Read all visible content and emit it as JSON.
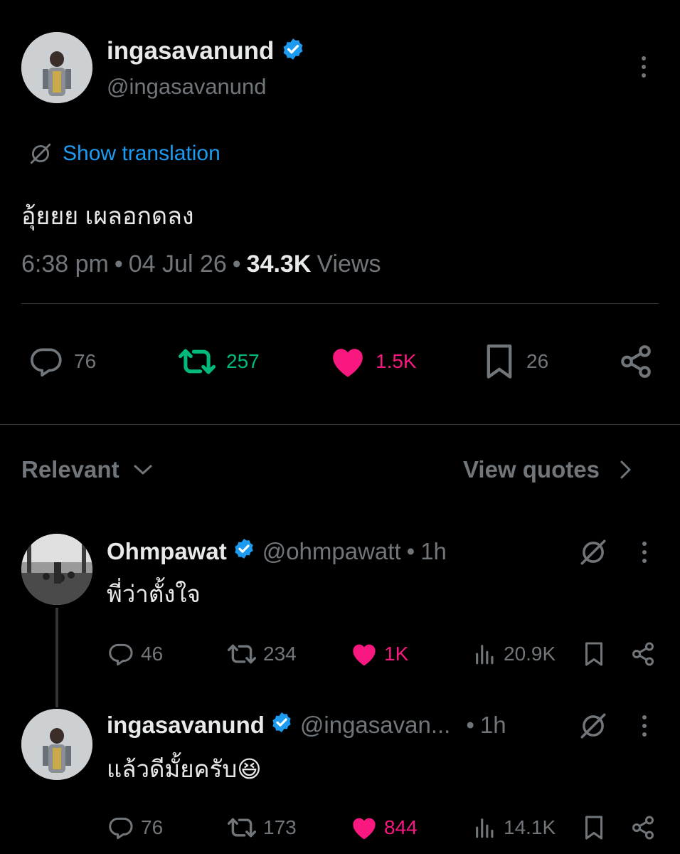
{
  "tweet": {
    "author_name": "ingasavanund",
    "author_handle": "@ingasavanund",
    "translate_label": "Show translation",
    "text": "อุ้ยยย เผลอกดลง",
    "time": "6:38 pm",
    "date": "04 Jul 26",
    "views_count": "34.3K",
    "views_label": "Views",
    "replies": "76",
    "retweets": "257",
    "likes": "1.5K",
    "bookmarks": "26"
  },
  "sort": {
    "label": "Relevant",
    "view_quotes": "View quotes"
  },
  "replies": [
    {
      "name": "Ohmpawat",
      "handle": "@ohmpawatt",
      "time": "1h",
      "text": "พี่ว่าตั้งใจ",
      "replies": "46",
      "retweets": "234",
      "likes": "1K",
      "views": "20.9K"
    },
    {
      "name": "ingasavanund",
      "handle": "@ingasavan...",
      "time": "1h",
      "text": "แล้วดีมั้ยครับ😆",
      "replies": "76",
      "retweets": "173",
      "likes": "844",
      "views": "14.1K"
    }
  ],
  "colors": {
    "background": "#000000",
    "text": "#e7e9ea",
    "muted": "#71767b",
    "link": "#1d9bf0",
    "retweet": "#00ba7c",
    "like": "#f91880",
    "verified": "#1d9bf0"
  },
  "icons": [
    "more-icon",
    "translate-icon",
    "reply-icon",
    "retweet-icon",
    "heart-icon",
    "bookmark-icon",
    "share-icon",
    "chevron-down-icon",
    "chevron-right-icon",
    "verified-badge-icon",
    "views-icon",
    "grok-icon"
  ]
}
